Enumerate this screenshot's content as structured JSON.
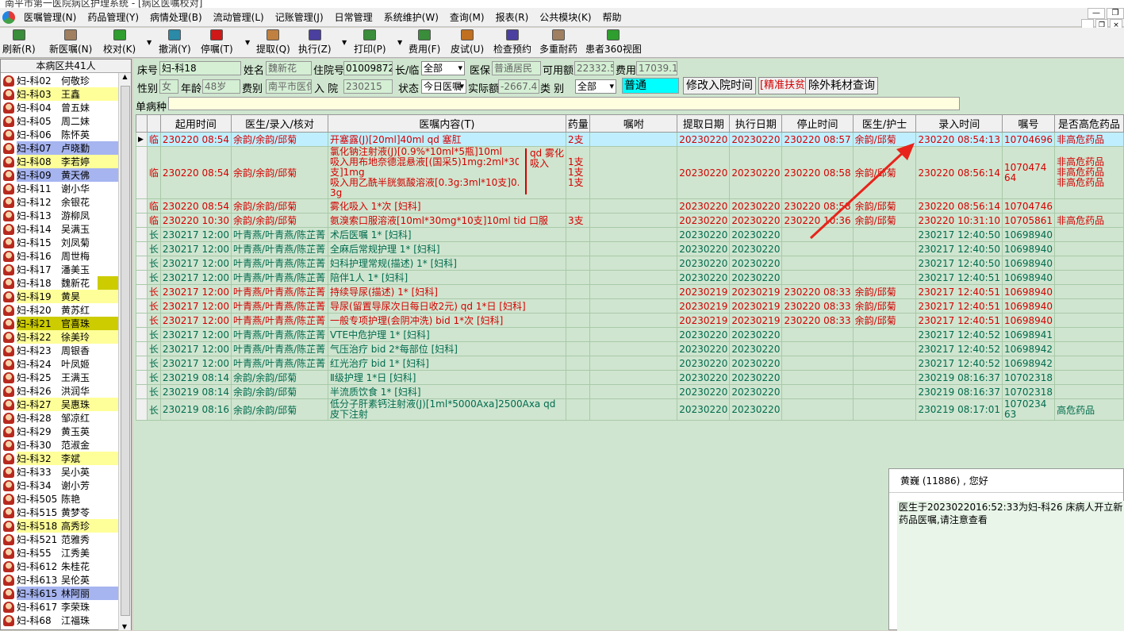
{
  "window_title": "南平市第一医院病区护理系统 - [病区医嘱校对]",
  "menu": [
    "医嘱管理(N)",
    "药品管理(Y)",
    "病情处理(B)",
    "流动管理(L)",
    "记账管理(J)",
    "日常管理",
    "系统维护(W)",
    "查询(M)",
    "报表(R)",
    "公共模块(K)",
    "帮助"
  ],
  "toolbar": [
    {
      "label": "刷新(R)",
      "icon": "refresh-icon",
      "color": "#3a8d3a"
    },
    {
      "label": "新医嘱(N)",
      "icon": "new-order-icon",
      "color": "#a08060"
    },
    {
      "label": "校对(K)",
      "icon": "check-icon",
      "color": "#2e9e2e"
    },
    {
      "label": "撤消(Y)",
      "icon": "undo-icon",
      "color": "#2a8aa8"
    },
    {
      "label": "停嘱(T)",
      "icon": "stop-icon",
      "color": "#d01818"
    },
    {
      "label": "提取(Q)",
      "icon": "extract-icon",
      "color": "#c08040"
    },
    {
      "label": "执行(Z)",
      "icon": "execute-icon",
      "color": "#4b3fa0"
    },
    {
      "label": "打印(P)",
      "icon": "print-icon",
      "color": "#3a8d3a"
    },
    {
      "label": "费用(F)",
      "icon": "fee-icon",
      "color": "#3a8d3a"
    },
    {
      "label": "皮试(U)",
      "icon": "skin-test-icon",
      "color": "#c07020"
    },
    {
      "label": "检查预约",
      "icon": "appointment-icon",
      "color": "#4b3fa0"
    },
    {
      "label": "多重耐药",
      "icon": "drug-resistance-icon",
      "color": "#a08060"
    },
    {
      "label": "患者360视图",
      "icon": "patient-360-icon",
      "color": "#2e9e2e"
    }
  ],
  "ward": {
    "header": "本病区共41人",
    "beds": [
      {
        "id": "妇-科02",
        "name": "何敬珍",
        "hl": ""
      },
      {
        "id": "妇-科03",
        "name": "王鑫",
        "hl": "yellow"
      },
      {
        "id": "妇-科04",
        "name": "曾五妹",
        "hl": ""
      },
      {
        "id": "妇-科05",
        "name": "周二妹",
        "hl": ""
      },
      {
        "id": "妇-科06",
        "name": "陈怀英",
        "hl": ""
      },
      {
        "id": "妇-科07",
        "name": "卢晓勤",
        "hl": "blue"
      },
      {
        "id": "妇-科08",
        "name": "李若婷",
        "hl": "yellow"
      },
      {
        "id": "妇-科09",
        "name": "黄天佛",
        "hl": "blue"
      },
      {
        "id": "妇-科11",
        "name": "谢小华",
        "hl": ""
      },
      {
        "id": "妇-科12",
        "name": "余银花",
        "hl": ""
      },
      {
        "id": "妇-科13",
        "name": "游柳凤",
        "hl": ""
      },
      {
        "id": "妇-科14",
        "name": "吴满玉",
        "hl": ""
      },
      {
        "id": "妇-科15",
        "name": "刘凤菊",
        "hl": ""
      },
      {
        "id": "妇-科16",
        "name": "周世梅",
        "hl": ""
      },
      {
        "id": "妇-科17",
        "name": "潘美玉",
        "hl": ""
      },
      {
        "id": "妇-科18",
        "name": "魏新花",
        "hl": "olive"
      },
      {
        "id": "妇-科19",
        "name": "黄昊",
        "hl": "yellow"
      },
      {
        "id": "妇-科20",
        "name": "黄苏红",
        "hl": ""
      },
      {
        "id": "妇-科21",
        "name": "官喜珠",
        "hl": "olive-full"
      },
      {
        "id": "妇-科22",
        "name": "徐美玲",
        "hl": "yellow"
      },
      {
        "id": "妇-科23",
        "name": "周银香",
        "hl": ""
      },
      {
        "id": "妇-科24",
        "name": "叶凤姬",
        "hl": ""
      },
      {
        "id": "妇-科25",
        "name": "王满玉",
        "hl": ""
      },
      {
        "id": "妇-科26",
        "name": "洪润华",
        "hl": ""
      },
      {
        "id": "妇-科27",
        "name": "吴惠珠",
        "hl": "yellow"
      },
      {
        "id": "妇-科28",
        "name": "邹凉红",
        "hl": ""
      },
      {
        "id": "妇-科29",
        "name": "黄玉英",
        "hl": ""
      },
      {
        "id": "妇-科30",
        "name": "范淑金",
        "hl": ""
      },
      {
        "id": "妇-科32",
        "name": "李斌",
        "hl": "yellow"
      },
      {
        "id": "妇-科33",
        "name": "吴小英",
        "hl": ""
      },
      {
        "id": "妇-科34",
        "name": "谢小芳",
        "hl": ""
      },
      {
        "id": "妇-科505",
        "name": "陈艳",
        "hl": ""
      },
      {
        "id": "妇-科515",
        "name": "黄梦苓",
        "hl": ""
      },
      {
        "id": "妇-科518",
        "name": "高秀珍",
        "hl": "yellow"
      },
      {
        "id": "妇-科521",
        "name": "范雅秀",
        "hl": ""
      },
      {
        "id": "妇-科55",
        "name": "江秀美",
        "hl": ""
      },
      {
        "id": "妇-科612",
        "name": "朱桂花",
        "hl": ""
      },
      {
        "id": "妇-科613",
        "name": "吴伦英",
        "hl": ""
      },
      {
        "id": "妇-科615",
        "name": "林阿丽",
        "hl": "blue"
      },
      {
        "id": "妇-科617",
        "name": "李荣珠",
        "hl": ""
      },
      {
        "id": "妇-科68",
        "name": "江福珠",
        "hl": ""
      }
    ]
  },
  "patient": {
    "bed_label": "床号",
    "bed": "妇-科18",
    "name_label": "姓名",
    "name": "魏新花",
    "admission_no_label": "住院号",
    "admission_no": "01009872",
    "type_label": "长/临",
    "type": "全部",
    "insurance_label": "医保",
    "insurance": "普通居民",
    "available_label": "可用额",
    "available": "22332.5",
    "fee_label": "费用",
    "fee": "17039.1",
    "sex_label": "性别",
    "sex": "女",
    "age_label": "年龄",
    "age": "48岁",
    "fee_type_label": "费别",
    "fee_type": "南平市医保",
    "admit_label": "入 院",
    "admit": "230215",
    "status_label": "状态",
    "status": "今日医嘱",
    "actual_label": "实际额",
    "actual": "-2667.4",
    "category_label": "类  别",
    "category": "全部",
    "level": "普通",
    "diagnosis_label": "单病种",
    "diagnosis": ""
  },
  "buttons": {
    "modify_admit_time": "修改入院时间",
    "precision_poverty": "[精准扶贫",
    "extra_consumables": "除外耗材查询"
  },
  "table": {
    "headers": [
      "",
      "起用时间",
      "医生/录入/核对",
      "医嘱内容(T)",
      "药量",
      "嘱咐",
      "提取日期",
      "执行日期",
      "停止时间",
      "医生/护士",
      "录入时间",
      "嘱号",
      "是否高危药品"
    ],
    "rows": [
      {
        "c": "red",
        "sel": true,
        "cells": [
          "临",
          "230220 08:54",
          "余韵/余韵/邱菊",
          "开塞露(J)[20ml]40ml qd 塞肛",
          "2支",
          "",
          "20230220",
          "20230220",
          "230220 08:57",
          "余韵/邱菊",
          "230220 08:54:13",
          "10704696",
          "非高危药品"
        ]
      },
      {
        "c": "red",
        "multi": true,
        "cells": [
          "临",
          "230220 08:54",
          "余韵/余韵/邱菊",
          "",
          "",
          "",
          "20230220",
          "20230220",
          "230220 08:58",
          "余韵/邱菊",
          "230220 08:56:14",
          "",
          "非高危药品"
        ],
        "content_lines": [
          "氯化钠注射液(J)[0.9%*10ml*5瓶]10ml",
          "吸入用布地奈德混悬液[(国采5)1mg:2ml*30",
          "支]1mg",
          "吸入用乙酰半胱氨酸溶液[0.3g:3ml*10支]0.",
          "3g"
        ],
        "group_note": [
          "qd 雾化",
          "吸入"
        ],
        "qty_lines": [
          "1支",
          "1支",
          "1支"
        ],
        "no_lines": [
          "1070474",
          "64"
        ],
        "risk_lines": [
          "非高危药品",
          "非高危药品",
          "非高危药品"
        ]
      },
      {
        "c": "red",
        "cells": [
          "临",
          "230220 08:54",
          "余韵/余韵/邱菊",
          "雾化吸入  1*次 [妇科]",
          "",
          "",
          "20230220",
          "20230220",
          "230220 08:58",
          "余韵/邱菊",
          "230220 08:56:14",
          "10704746",
          ""
        ]
      },
      {
        "c": "red",
        "cells": [
          "临",
          "230220 10:30",
          "余韵/余韵/邱菊",
          "氨溴索口服溶液[10ml*30mg*10支]10ml tid 口服",
          "3支",
          "",
          "20230220",
          "20230220",
          "230220 10:36",
          "余韵/邱菊",
          "230220 10:31:10",
          "10705861",
          "非高危药品"
        ]
      },
      {
        "c": "grn",
        "cells": [
          "长",
          "230217 12:00",
          "叶青燕/叶青燕/陈芷菁",
          "术后医嘱  1* [妇科]",
          "",
          "",
          "20230220",
          "20230220",
          "",
          "",
          "230217 12:40:50",
          "10698940",
          ""
        ]
      },
      {
        "c": "grn",
        "cells": [
          "长",
          "230217 12:00",
          "叶青燕/叶青燕/陈芷菁",
          "全麻后常规护理  1* [妇科]",
          "",
          "",
          "20230220",
          "20230220",
          "",
          "",
          "230217 12:40:50",
          "10698940",
          ""
        ]
      },
      {
        "c": "grn",
        "cells": [
          "长",
          "230217 12:00",
          "叶青燕/叶青燕/陈芷菁",
          "妇科护理常规(描述)  1* [妇科]",
          "",
          "",
          "20230220",
          "20230220",
          "",
          "",
          "230217 12:40:50",
          "10698940",
          ""
        ]
      },
      {
        "c": "grn",
        "cells": [
          "长",
          "230217 12:00",
          "叶青燕/叶青燕/陈芷菁",
          "陪伴1人  1* [妇科]",
          "",
          "",
          "20230220",
          "20230220",
          "",
          "",
          "230217 12:40:51",
          "10698940",
          ""
        ]
      },
      {
        "c": "red",
        "cells": [
          "长",
          "230217 12:00",
          "叶青燕/叶青燕/陈芷菁",
          "持续导尿(描述)  1* [妇科]",
          "",
          "",
          "20230219",
          "20230219",
          "230220 08:33",
          "余韵/邱菊",
          "230217 12:40:51",
          "10698940",
          ""
        ]
      },
      {
        "c": "red",
        "cells": [
          "长",
          "230217 12:00",
          "叶青燕/叶青燕/陈芷菁",
          "导尿(留置导尿次日每日收2元) qd 1*日 [妇科]",
          "",
          "",
          "20230219",
          "20230219",
          "230220 08:33",
          "余韵/邱菊",
          "230217 12:40:51",
          "10698940",
          ""
        ]
      },
      {
        "c": "red",
        "cells": [
          "长",
          "230217 12:00",
          "叶青燕/叶青燕/陈芷菁",
          "一般专项护理(会阴冲洗) bid 1*次 [妇科]",
          "",
          "",
          "20230219",
          "20230219",
          "230220 08:33",
          "余韵/邱菊",
          "230217 12:40:51",
          "10698940",
          ""
        ]
      },
      {
        "c": "grn",
        "cells": [
          "长",
          "230217 12:00",
          "叶青燕/叶青燕/陈芷菁",
          "VTE中危护理  1* [妇科]",
          "",
          "",
          "20230220",
          "20230220",
          "",
          "",
          "230217 12:40:52",
          "10698941",
          ""
        ]
      },
      {
        "c": "grn",
        "cells": [
          "长",
          "230217 12:00",
          "叶青燕/叶青燕/陈芷菁",
          "气压治疗 bid 2*每部位 [妇科]",
          "",
          "",
          "20230220",
          "20230220",
          "",
          "",
          "230217 12:40:52",
          "10698942",
          ""
        ]
      },
      {
        "c": "grn",
        "cells": [
          "长",
          "230217 12:00",
          "叶青燕/叶青燕/陈芷菁",
          "红光治疗 bid 1* [妇科]",
          "",
          "",
          "20230220",
          "20230220",
          "",
          "",
          "230217 12:40:52",
          "10698942",
          ""
        ]
      },
      {
        "c": "grn",
        "cells": [
          "长",
          "230219 08:14",
          "余韵/余韵/邱菊",
          "Ⅱ级护理  1*日 [妇科]",
          "",
          "",
          "20230220",
          "20230220",
          "",
          "",
          "230219 08:16:37",
          "10702318",
          ""
        ]
      },
      {
        "c": "grn",
        "cells": [
          "长",
          "230219 08:14",
          "余韵/余韵/邱菊",
          "半流质饮食  1* [妇科]",
          "",
          "",
          "20230220",
          "20230220",
          "",
          "",
          "230219 08:16:37",
          "10702318",
          ""
        ]
      },
      {
        "c": "grn",
        "multi2": true,
        "cells": [
          "长",
          "230219 08:16",
          "余韵/余韵/邱菊",
          "",
          "",
          "",
          "20230220",
          "20230220",
          "",
          "",
          "230219 08:17:01",
          "",
          "高危药品"
        ],
        "content_lines": [
          "低分子肝素钙注射液(J)[1ml*5000Axa]2500Axa qd",
          "皮下注射"
        ],
        "no_lines": [
          "1070234",
          "63"
        ]
      }
    ]
  },
  "message": {
    "greeting": "黄巍 (11886) , 您好",
    "body": "医生于2023022016:52:33为妇-科26  床病人开立新药品医嘱,请注意查看"
  },
  "colors": {
    "order_red": "#d40000",
    "order_green": "#006b4e",
    "selected_row": "#bfefff",
    "panel_bg": "#cfe5cf",
    "annotation_arrow": "#e8231b"
  }
}
